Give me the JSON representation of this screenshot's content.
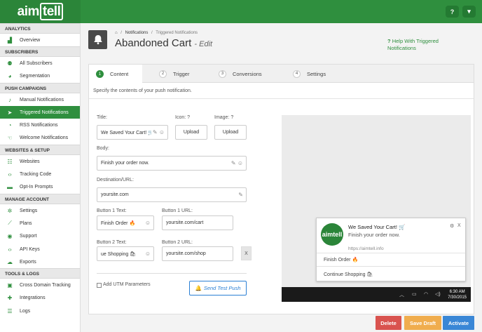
{
  "brand": {
    "logo_prefix": "aim",
    "logo_boxed": "tell"
  },
  "topbar": {
    "help_icon": "question-icon",
    "help_glyph": "?",
    "menu_icon": "chevron-down-icon",
    "menu_glyph": "▾"
  },
  "sidebar": {
    "sections": [
      {
        "title": "ANALYTICS",
        "items": [
          {
            "label": "Overview",
            "icon": "chart-icon",
            "glyph": "▟"
          }
        ]
      },
      {
        "title": "SUBSCRIBERS",
        "items": [
          {
            "label": "All Subscribers",
            "icon": "users-icon",
            "glyph": "⚉"
          },
          {
            "label": "Segmentation",
            "icon": "pie-icon",
            "glyph": "◕"
          }
        ]
      },
      {
        "title": "PUSH CAMPAIGNS",
        "items": [
          {
            "label": "Manual Notifications",
            "icon": "bell-icon",
            "glyph": "♪"
          },
          {
            "label": "Triggered Notifications",
            "icon": "send-icon",
            "glyph": "➤",
            "active": true
          },
          {
            "label": "RSS Notifications",
            "icon": "rss-icon",
            "glyph": "◔"
          },
          {
            "label": "Welcome Notifications",
            "icon": "hand-icon",
            "glyph": "☜"
          }
        ]
      },
      {
        "title": "WEBSITES & SETUP",
        "items": [
          {
            "label": "Websites",
            "icon": "sitemap-icon",
            "glyph": "☷"
          },
          {
            "label": "Tracking Code",
            "icon": "code-icon",
            "glyph": "‹›"
          },
          {
            "label": "Opt-In Prompts",
            "icon": "window-icon",
            "glyph": "▬"
          }
        ]
      },
      {
        "title": "MANAGE ACCOUNT",
        "items": [
          {
            "label": "Settings",
            "icon": "gears-icon",
            "glyph": "✲"
          },
          {
            "label": "Plans",
            "icon": "line-chart-icon",
            "glyph": "⟋"
          },
          {
            "label": "Support",
            "icon": "life-ring-icon",
            "glyph": "◉"
          },
          {
            "label": "API Keys",
            "icon": "code-icon",
            "glyph": "‹›"
          },
          {
            "label": "Exports",
            "icon": "cloud-download-icon",
            "glyph": "☁"
          }
        ]
      },
      {
        "title": "TOOLS & LOGS",
        "items": [
          {
            "label": "Cross Domain Tracking",
            "icon": "browser-icon",
            "glyph": "▣"
          },
          {
            "label": "Integrations",
            "icon": "puzzle-icon",
            "glyph": "✚"
          },
          {
            "label": "Logs",
            "icon": "list-icon",
            "glyph": "☰"
          }
        ]
      }
    ]
  },
  "header": {
    "breadcrumb": [
      "Notifications",
      "Triggered Notifications"
    ],
    "crumb_sep": "/",
    "title": "Abandoned Cart",
    "title_suffix": "- Edit",
    "help_link": "Help With Triggered Notifications"
  },
  "tabs": [
    {
      "num": "1",
      "label": "Content",
      "active": true
    },
    {
      "num": "2",
      "label": "Trigger"
    },
    {
      "num": "3",
      "label": "Conversions"
    },
    {
      "num": "4",
      "label": "Settings"
    }
  ],
  "form": {
    "description": "Specify the contents of your push notification.",
    "title_label": "Title:",
    "title_value": "We Saved Your Cart! 🛒",
    "icon_label": "Icon:",
    "image_label": "Image:",
    "upload_label": "Upload",
    "body_label": "Body:",
    "body_value": "Finish your order now.",
    "dest_label": "Destination/URL:",
    "dest_value": "yoursite.com",
    "btn1_text_label": "Button 1 Text:",
    "btn1_text_value": "Finish Order 🔥",
    "btn1_url_label": "Button 1 URL:",
    "btn1_url_value": "yoursite.com/cart",
    "btn2_text_label": "Button 2 Text:",
    "btn2_text_value": "ue Shopping 🛍",
    "btn2_url_label": "Button 2 URL:",
    "btn2_url_value": "yoursite.com/shop",
    "remove_label": "X",
    "utm_label": "Add UTM Parameters",
    "send_test_label": "Send Test Push"
  },
  "preview": {
    "logo": "aimtell",
    "title": "We Saved Your Cart! 🛒",
    "body": "Finish your order now.",
    "url": "https://aimtell.info",
    "close": "X",
    "action1": "Finish Order 🔥",
    "action2": "Continue Shopping 🛍",
    "time": "6:30 AM",
    "date": "7/30/2015"
  },
  "footer": {
    "delete": "Delete",
    "save_draft": "Save Draft",
    "activate": "Activate"
  },
  "colors": {
    "brand_green": "#2f8f3e",
    "delete_red": "#d9534f",
    "draft_orange": "#f0ad4e",
    "activate_blue": "#3a87d6"
  }
}
